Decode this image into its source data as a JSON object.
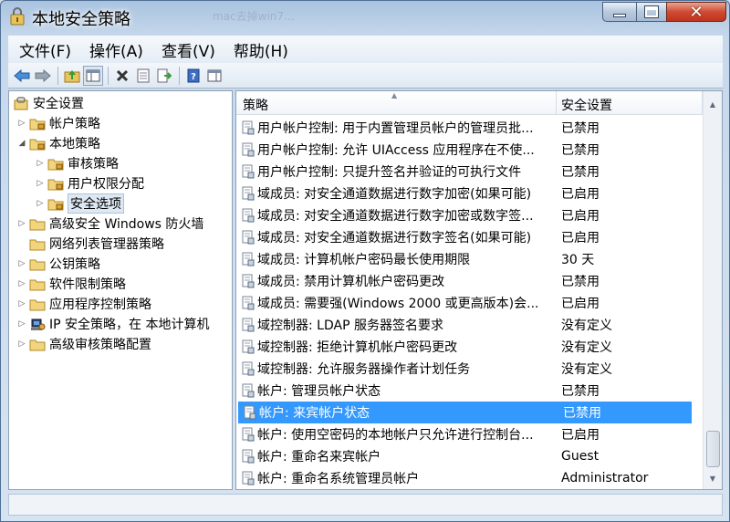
{
  "window": {
    "title": "本地安全策略",
    "ghost_title": "mac去掉win7..."
  },
  "menu": [
    "文件(F)",
    "操作(A)",
    "查看(V)",
    "帮助(H)"
  ],
  "toolbar_icons": [
    "back-arrow-icon",
    "forward-arrow-icon",
    "up-folder-icon",
    "show-hide-tree-icon",
    "delete-icon",
    "properties-icon",
    "export-list-icon",
    "help-icon",
    "show-hide-action-pane-icon"
  ],
  "tree": [
    {
      "label": "安全设置",
      "level": 0,
      "arrow": "",
      "icon": "security-settings-icon"
    },
    {
      "label": "帐户策略",
      "level": 1,
      "arrow": "▷",
      "icon": "folder-lock-icon"
    },
    {
      "label": "本地策略",
      "level": 1,
      "arrow": "◢",
      "icon": "folder-lock-icon"
    },
    {
      "label": "审核策略",
      "level": 2,
      "arrow": "▷",
      "icon": "folder-lock-icon"
    },
    {
      "label": "用户权限分配",
      "level": 2,
      "arrow": "▷",
      "icon": "folder-lock-icon"
    },
    {
      "label": "安全选项",
      "level": 2,
      "arrow": "▷",
      "icon": "folder-lock-icon",
      "selected": true
    },
    {
      "label": "高级安全 Windows 防火墙",
      "level": 1,
      "arrow": "▷",
      "icon": "folder-icon"
    },
    {
      "label": "网络列表管理器策略",
      "level": 1,
      "arrow": "",
      "icon": "folder-icon"
    },
    {
      "label": "公钥策略",
      "level": 1,
      "arrow": "▷",
      "icon": "folder-icon"
    },
    {
      "label": "软件限制策略",
      "level": 1,
      "arrow": "▷",
      "icon": "folder-icon"
    },
    {
      "label": "应用程序控制策略",
      "level": 1,
      "arrow": "▷",
      "icon": "folder-icon"
    },
    {
      "label": "IP 安全策略，在 本地计算机",
      "level": 1,
      "arrow": "▷",
      "icon": "ip-security-icon"
    },
    {
      "label": "高级审核策略配置",
      "level": 1,
      "arrow": "▷",
      "icon": "folder-icon"
    }
  ],
  "list": {
    "col_policy": "策略",
    "col_setting": "安全设置",
    "rows": [
      {
        "policy": "用户帐户控制: 用于内置管理员帐户的管理员批...",
        "setting": "已禁用"
      },
      {
        "policy": "用户帐户控制: 允许 UIAccess 应用程序在不使...",
        "setting": "已禁用"
      },
      {
        "policy": "用户帐户控制: 只提升签名并验证的可执行文件",
        "setting": "已禁用"
      },
      {
        "policy": "域成员: 对安全通道数据进行数字加密(如果可能)",
        "setting": "已启用"
      },
      {
        "policy": "域成员: 对安全通道数据进行数字加密或数字签...",
        "setting": "已启用"
      },
      {
        "policy": "域成员: 对安全通道数据进行数字签名(如果可能)",
        "setting": "已启用"
      },
      {
        "policy": "域成员: 计算机帐户密码最长使用期限",
        "setting": "30 天"
      },
      {
        "policy": "域成员: 禁用计算机帐户密码更改",
        "setting": "已禁用"
      },
      {
        "policy": "域成员: 需要强(Windows 2000 或更高版本)会...",
        "setting": "已启用"
      },
      {
        "policy": "域控制器: LDAP 服务器签名要求",
        "setting": "没有定义"
      },
      {
        "policy": "域控制器: 拒绝计算机帐户密码更改",
        "setting": "没有定义"
      },
      {
        "policy": "域控制器: 允许服务器操作者计划任务",
        "setting": "没有定义"
      },
      {
        "policy": "帐户: 管理员帐户状态",
        "setting": "已禁用"
      },
      {
        "policy": "帐户: 来宾帐户状态",
        "setting": "已禁用",
        "selected": true
      },
      {
        "policy": "帐户: 使用空密码的本地帐户只允许进行控制台...",
        "setting": "已启用"
      },
      {
        "policy": "帐户: 重命名来宾帐户",
        "setting": "Guest"
      },
      {
        "policy": "帐户: 重命名系统管理员帐户",
        "setting": "Administrator"
      }
    ]
  },
  "colors": {
    "selection": "#3399ff",
    "close_button": "#cf4b33"
  }
}
